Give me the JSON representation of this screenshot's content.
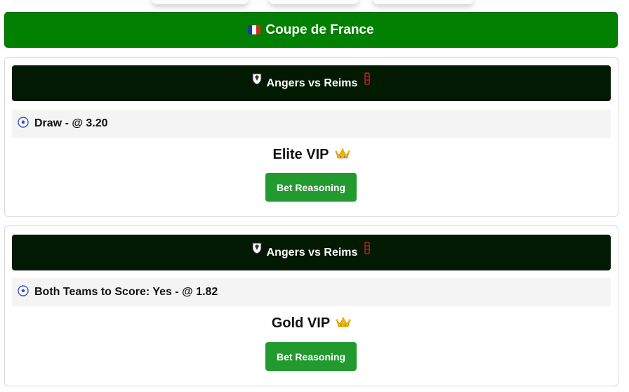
{
  "league": {
    "flag_colors": [
      "#1f3d99",
      "#ffffff",
      "#d52b1e"
    ],
    "name": "Coupe de France"
  },
  "colors": {
    "league_bar": "#028002",
    "match_header": "#021a02",
    "pick_row_bg": "#f4f4f4",
    "button": "#239a2f"
  },
  "bets": [
    {
      "match": "Angers vs Reims",
      "home_crest_icon": "angers-crest-icon",
      "away_crest_icon": "reims-crest-icon",
      "pick_icon": "soccer-ball-icon",
      "pick": "Draw - @ 3.20",
      "tier": "Elite VIP",
      "tier_icon": "crown-icon",
      "button_label": "Bet Reasoning"
    },
    {
      "match": "Angers vs Reims",
      "home_crest_icon": "angers-crest-icon",
      "away_crest_icon": "reims-crest-icon",
      "pick_icon": "soccer-ball-icon",
      "pick": "Both Teams to Score: Yes - @ 1.82",
      "tier": "Gold VIP",
      "tier_icon": "crown-icon",
      "button_label": "Bet Reasoning"
    }
  ]
}
